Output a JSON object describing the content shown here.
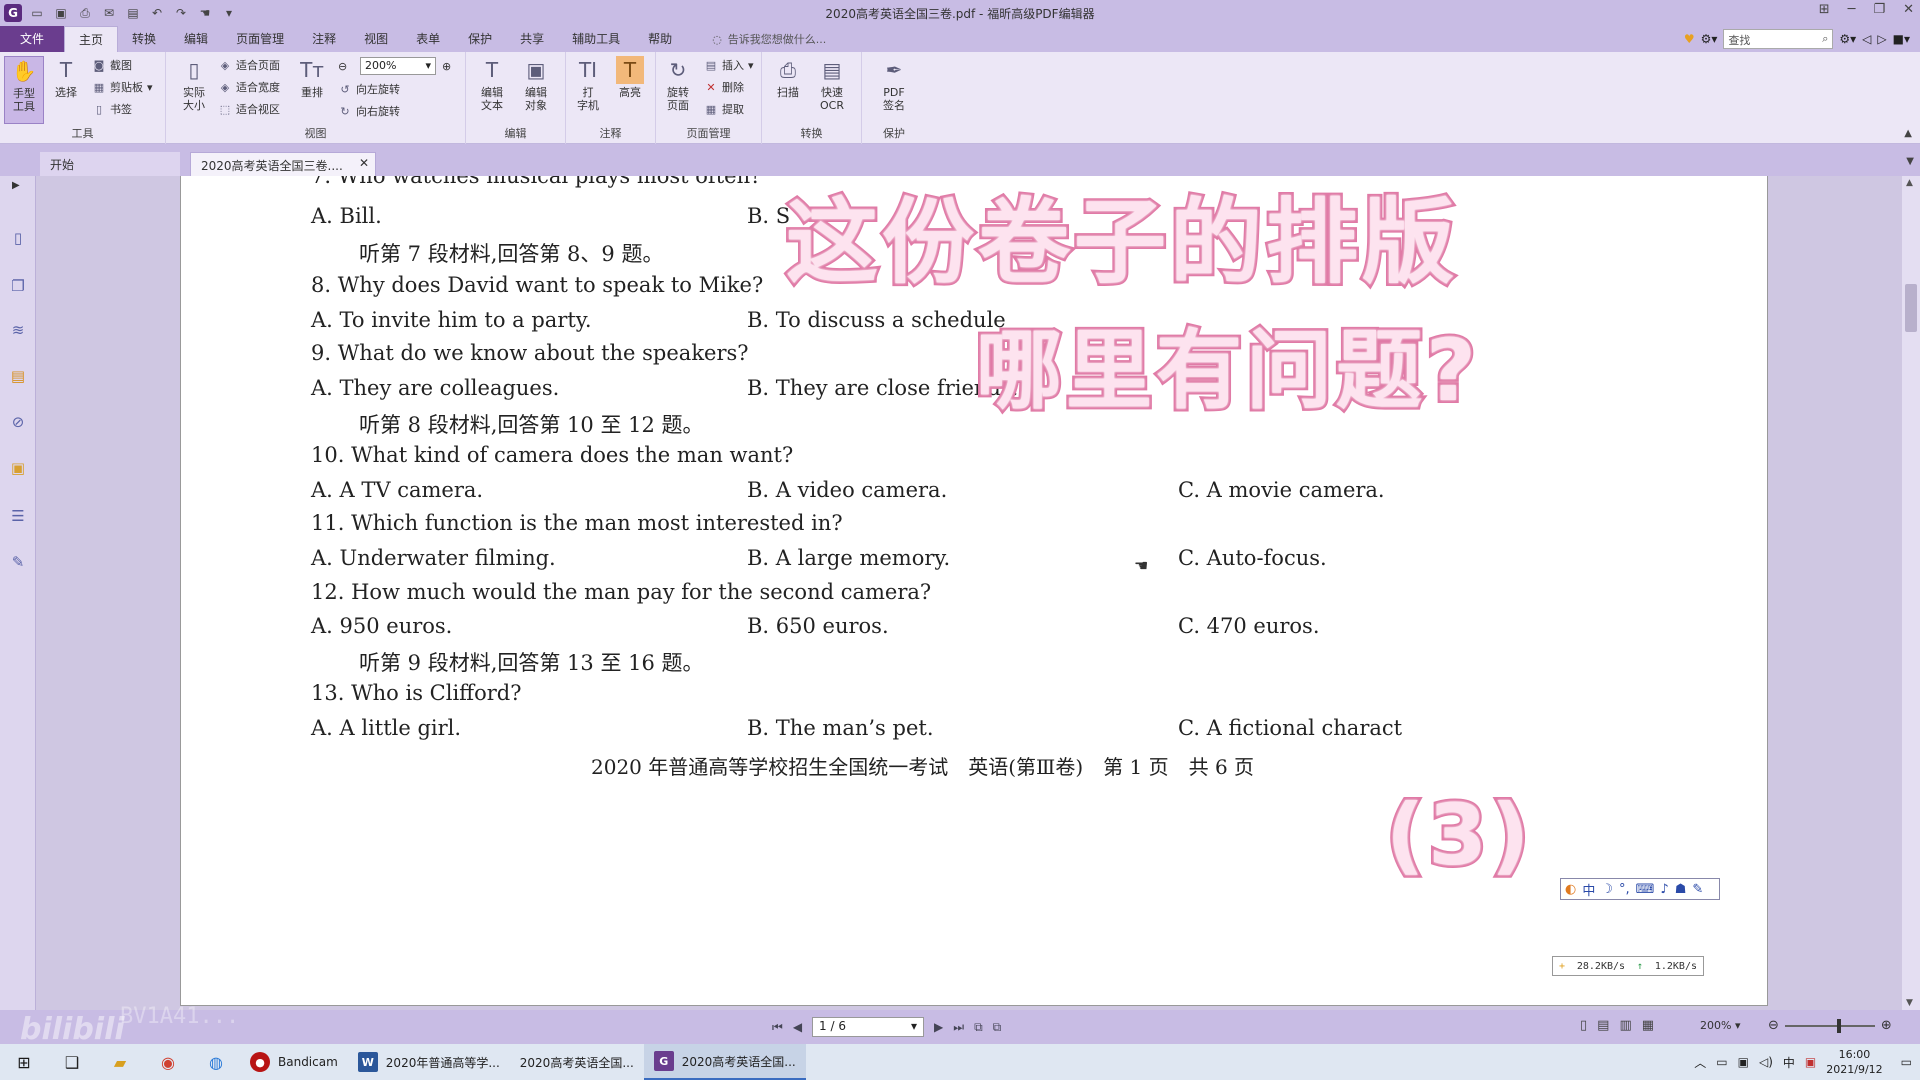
{
  "window": {
    "title": "2020高考英语全国三卷.pdf - 福昕高级PDF编辑器"
  },
  "menu": {
    "tabs": [
      "文件",
      "主页",
      "转换",
      "编辑",
      "页面管理",
      "注释",
      "视图",
      "表单",
      "保护",
      "共享",
      "辅助工具",
      "帮助"
    ],
    "tell_me": "告诉我您想做什么...",
    "search_placeholder": "查找"
  },
  "ribbon": {
    "hand_tool": "手型\n工具",
    "select": "选择",
    "screenshot": "截图",
    "clipboard": "剪贴板",
    "bookmark": "书签",
    "tools_group": "工具",
    "actual_size": "实际\n大小",
    "fit_page": "适合页面",
    "fit_width": "适合宽度",
    "fit_view": "适合视区",
    "reflow": "重排",
    "zoom_value": "200%",
    "rotate_left": "向左旋转",
    "rotate_right": "向右旋转",
    "view_group": "视图",
    "edit_text": "编辑\n文本",
    "edit_object": "编辑\n对象",
    "edit_group": "编辑",
    "typewriter": "打\n字机",
    "highlight": "高亮",
    "comment_group": "注释",
    "rotate_page": "旋转\n页面",
    "insert": "插入",
    "delete": "删除",
    "extract": "提取",
    "page_group": "页面管理",
    "scan": "扫描",
    "quick_ocr": "快速\nOCR",
    "convert_group": "转换",
    "pdf_sign": "PDF\n签名",
    "protect_group": "保护"
  },
  "doctabs": {
    "start": "开始",
    "current": "2020高考英语全国三卷...."
  },
  "document": {
    "lines": [
      "7. Who watches musical plays most often?",
      "A. Bill.",
      "B. S",
      "听第 7 段材料,回答第 8、9 题。",
      "8. Why does David want to speak to Mike?",
      "A. To invite him to a party.",
      "B. To discuss a schedule",
      "9. What do we know about the speakers?",
      "A. They are colleagues.",
      "B. They are close friends.",
      "听第 8 段材料,回答第 10 至 12 题。",
      "10. What kind of camera does the man want?",
      "A. A TV camera.",
      "B. A video camera.",
      "C. A movie camera.",
      "11. Which function is the man most interested in?",
      "A. Underwater filming.",
      "B. A large memory.",
      "C. Auto-focus.",
      "12. How much would the man pay for the second camera?",
      "A. 950 euros.",
      "B. 650 euros.",
      "C. 470 euros.",
      "听第 9 段材料,回答第 13 至 16 题。",
      "13. Who is Clifford?",
      "A. A little girl.",
      "B. The man’s pet.",
      "C. A fictional charact"
    ],
    "footer": "2020 年普通高等学校招生全国统一考试　英语(第Ⅲ卷)　第 1 页　共 6 页"
  },
  "overlay": {
    "line1": "这份卷子的排版",
    "line2": "哪里有问题?",
    "badge": "(3)"
  },
  "net_speed": {
    "down": "28.2KB/s",
    "up": "1.2KB/s"
  },
  "status": {
    "page": "1 / 6",
    "zoom": "200%"
  },
  "taskbar": {
    "apps": [
      {
        "label": "Bandicam",
        "color": "#b81414"
      },
      {
        "label": "2020年普通高等学...",
        "color": "#2b579a"
      },
      {
        "label": "2020高考英语全国...",
        "color": "#8a8a8a"
      },
      {
        "label": "2020高考英语全国...",
        "color": "#6a3d8e"
      }
    ],
    "time": "16:00",
    "date": "2021/9/12"
  },
  "watermark": {
    "text": "bilibili",
    "sub": "BV1A41..."
  }
}
